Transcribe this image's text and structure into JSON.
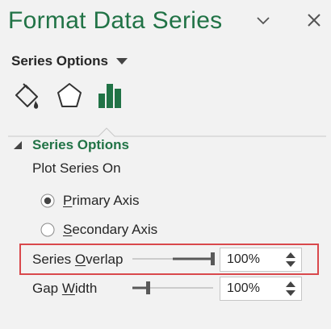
{
  "pane": {
    "title": "Format Data Series",
    "dropdown_icon": "chevron-down-icon",
    "close_icon": "close-icon"
  },
  "menu": {
    "label": "Series Options",
    "caret_icon": "caret-down-icon"
  },
  "tabs": [
    {
      "name": "fill-line",
      "icon": "paint-bucket-icon",
      "selected": false
    },
    {
      "name": "effects",
      "icon": "pentagon-icon",
      "selected": false
    },
    {
      "name": "series-options",
      "icon": "bar-chart-icon",
      "selected": true
    }
  ],
  "section": {
    "label": "Series Options",
    "expanded": true
  },
  "plot_series_on": {
    "label": "Plot Series On",
    "options": [
      {
        "label_pre": "",
        "label_ul": "P",
        "label_post": "rimary Axis",
        "checked": true
      },
      {
        "label_pre": "",
        "label_ul": "S",
        "label_post": "econdary Axis",
        "checked": false
      }
    ]
  },
  "series_overlap": {
    "label_pre": "Series ",
    "label_ul": "O",
    "label_post": "verlap",
    "value": "100%",
    "level": 1.0
  },
  "gap_width": {
    "label_pre": "Gap ",
    "label_ul": "W",
    "label_post": "idth",
    "value": "100%",
    "level": 0.2
  },
  "colors": {
    "accent": "#217346",
    "highlight_border": "#d9484c",
    "background": "#f2f2f2"
  }
}
